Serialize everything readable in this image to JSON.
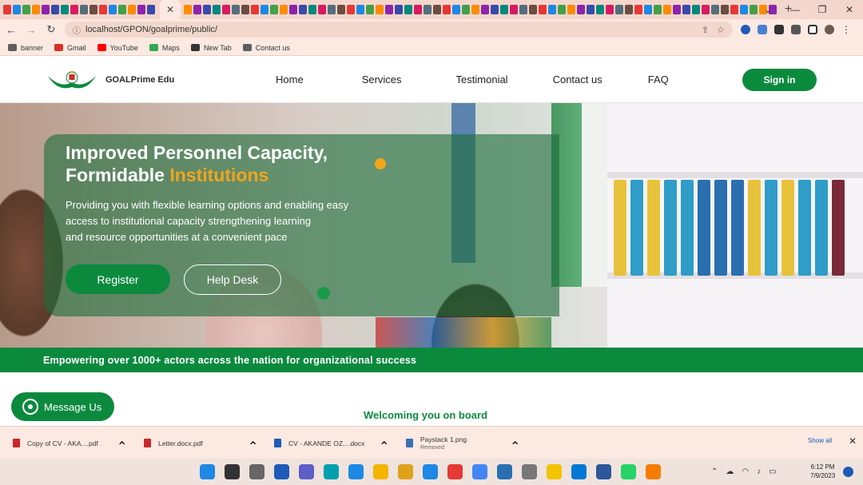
{
  "browser": {
    "active_tab_close": "✕",
    "new_tab": "+",
    "window_controls": [
      "⌄",
      "—",
      "❐",
      "✕"
    ],
    "url": "localhost/GPON/goalprime/public/",
    "bookmarks": [
      {
        "label": "banner",
        "icon": "bookmark-icon",
        "color": "#5f5f5f"
      },
      {
        "label": "Gmail",
        "icon": "gmail-icon",
        "color": "#d93025"
      },
      {
        "label": "YouTube",
        "icon": "youtube-icon",
        "color": "#ff0000"
      },
      {
        "label": "Maps",
        "icon": "maps-icon",
        "color": "#34a853"
      },
      {
        "label": "New Tab",
        "icon": "chrome-icon",
        "color": "#333333"
      },
      {
        "label": "Contact us",
        "icon": "page-icon",
        "color": "#5f5f5f"
      }
    ]
  },
  "site": {
    "brand": "GOALPrime Edu",
    "nav": [
      "Home",
      "Services",
      "Testimonial",
      "Contact us",
      "FAQ"
    ],
    "signin": "Sign in",
    "hero": {
      "title_line1": "Improved Personnel Capacity,",
      "title_line2_plain": "Formidable ",
      "title_line2_accent": "Institutions",
      "text_line1": "Providing you with flexible learning options and enabling easy",
      "text_line2": "access to institutional capacity strengthening learning",
      "text_line3": "and resource opportunities at a convenient pace",
      "register": "Register",
      "helpdesk": "Help Desk"
    },
    "banner": "Empowering over 1000+ actors across the nation for organizational success",
    "welcome": "Welcoming you on board",
    "message_us": "Message Us",
    "colors": {
      "primary": "#0b8a3e",
      "accent": "#f2a51c"
    }
  },
  "downloads": {
    "items": [
      {
        "name": "Copy of CV - AKA....pdf",
        "sub": "",
        "color": "#c62828"
      },
      {
        "name": "Letter.docx.pdf",
        "sub": "",
        "color": "#c62828"
      },
      {
        "name": "CV - AKANDE OZ....docx",
        "sub": "",
        "color": "#1e5bb8"
      },
      {
        "name": "Paystack 1.png",
        "sub": "Removed",
        "color": "#3b6fb6"
      }
    ],
    "show_all": "Show all",
    "close": "✕"
  },
  "taskbar": {
    "time": "6:12 PM",
    "date": "7/9/2023"
  }
}
